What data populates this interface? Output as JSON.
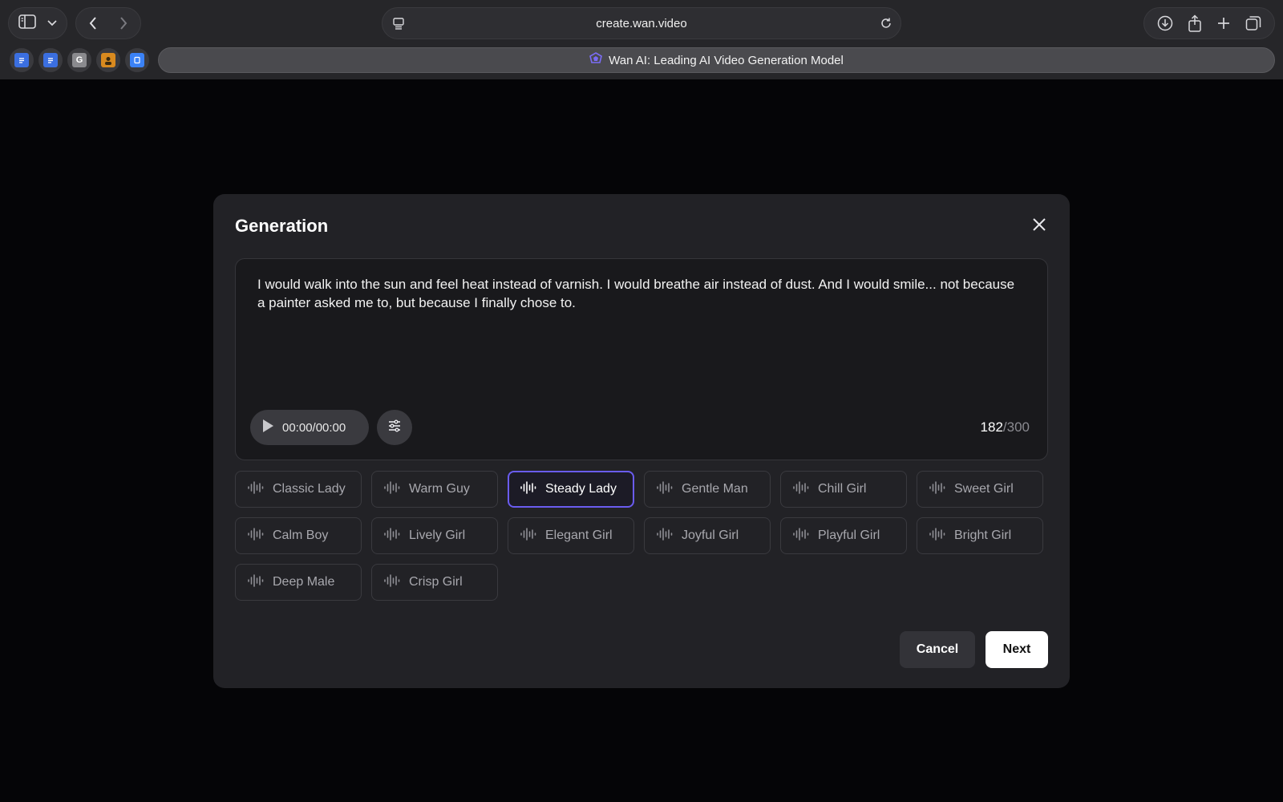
{
  "browser": {
    "url": "create.wan.video",
    "tab_title": "Wan AI: Leading AI Video Generation Model",
    "favorites": [
      {
        "name": "docs-1",
        "color": "#3b6fe0",
        "glyph": ""
      },
      {
        "name": "docs-2",
        "color": "#3b6fe0",
        "glyph": ""
      },
      {
        "name": "g-site",
        "color": "#8a8a8e",
        "glyph": "G"
      },
      {
        "name": "avatar-site",
        "color": "#d98a1f",
        "glyph": ""
      },
      {
        "name": "bookmark-site",
        "color": "#3b82f6",
        "glyph": ""
      }
    ]
  },
  "modal": {
    "title": "Generation",
    "prompt_text": "I would walk into the sun and feel heat instead of varnish. I would breathe air instead of dust. And I would smile... not because a painter asked me to, but because I finally chose to.",
    "player_time": "00:00/00:00",
    "char_count": "182",
    "char_max": "/300",
    "voices": [
      {
        "label": "Classic Lady",
        "selected": false
      },
      {
        "label": "Warm Guy",
        "selected": false
      },
      {
        "label": "Steady Lady",
        "selected": true
      },
      {
        "label": "Gentle Man",
        "selected": false
      },
      {
        "label": "Chill Girl",
        "selected": false
      },
      {
        "label": "Sweet Girl",
        "selected": false
      },
      {
        "label": "Calm Boy",
        "selected": false
      },
      {
        "label": "Lively Girl",
        "selected": false
      },
      {
        "label": "Elegant Girl",
        "selected": false
      },
      {
        "label": "Joyful Girl",
        "selected": false
      },
      {
        "label": "Playful Girl",
        "selected": false
      },
      {
        "label": "Bright Girl",
        "selected": false
      },
      {
        "label": "Deep Male",
        "selected": false
      },
      {
        "label": "Crisp Girl",
        "selected": false
      }
    ],
    "cancel_label": "Cancel",
    "next_label": "Next",
    "accent_color": "#6a5cf0"
  }
}
